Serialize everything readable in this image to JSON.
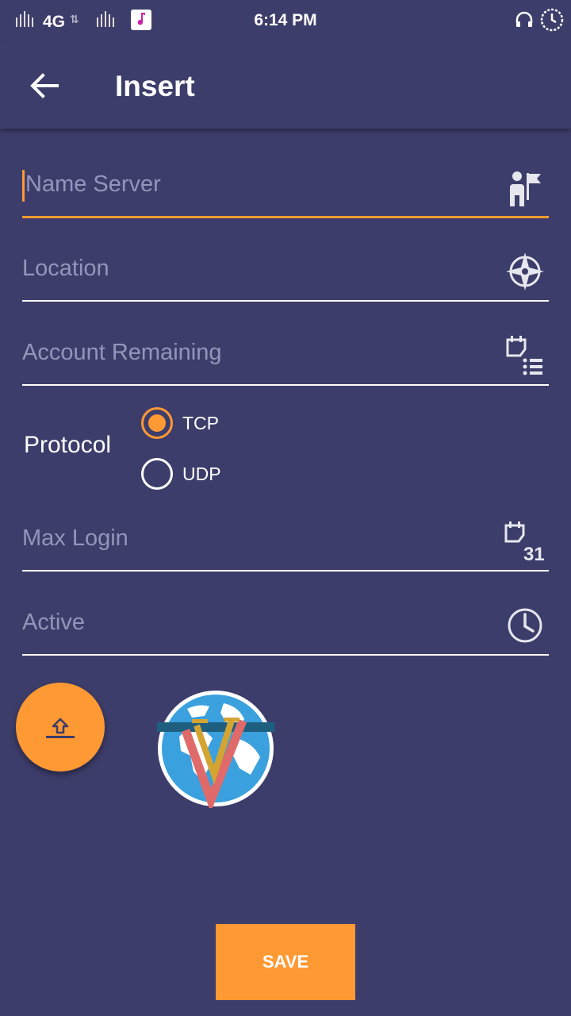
{
  "status_bar": {
    "network": "4G",
    "time": "6:14 PM"
  },
  "app_bar": {
    "title": "Insert",
    "back_icon": "arrow-left-icon"
  },
  "form": {
    "fields": [
      {
        "placeholder": "Name Server",
        "icon": "person-flag-icon",
        "focused": true
      },
      {
        "placeholder": "Location",
        "icon": "compass-icon",
        "focused": false
      },
      {
        "placeholder": "Account Remaining",
        "icon": "calendar-list-icon",
        "focused": false
      },
      {
        "placeholder": "Max Login",
        "icon": "calendar-31-icon",
        "focused": false
      },
      {
        "placeholder": "Active",
        "icon": "clock-icon",
        "focused": false
      }
    ],
    "protocol": {
      "label": "Protocol",
      "options": [
        "TCP",
        "UDP"
      ],
      "selected": "TCP"
    }
  },
  "calendar_day": "31",
  "upload_fab_icon": "upload-icon",
  "save_label": "SAVE",
  "colors": {
    "background": "#3d3d6b",
    "accent": "#ff9933",
    "hint_text": "#9595bb"
  }
}
